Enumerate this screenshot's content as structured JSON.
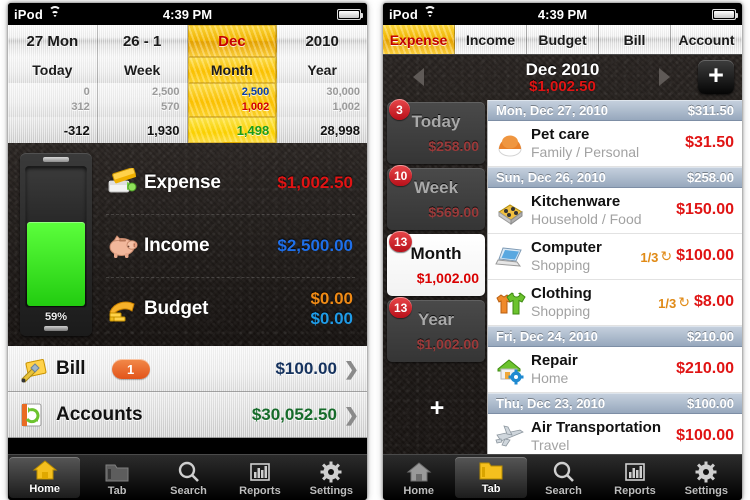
{
  "status_bar": {
    "carrier": "iPod",
    "time": "4:39 PM",
    "wifi_icon": "wifi-icon",
    "battery_icon": "battery-icon"
  },
  "home": {
    "summary": {
      "periods": [
        "27 Mon",
        "26 - 1",
        "Dec",
        "2010"
      ],
      "labels": [
        "Today",
        "Week",
        "Month",
        "Year"
      ],
      "income_row": [
        "0",
        "2,500",
        "2,500",
        "30,000"
      ],
      "expense_row": [
        "312",
        "570",
        "1,002",
        "1,002"
      ],
      "totals": [
        "-312",
        "1,930",
        "1,498",
        "28,998"
      ],
      "selected_index": 2
    },
    "battery": {
      "percent_label": "59%",
      "fill_percent": 59
    },
    "money_rows": [
      {
        "icon": "expense-icon",
        "label": "Expense",
        "values": [
          {
            "text": "$1,002.50",
            "color": "#e01414"
          }
        ]
      },
      {
        "icon": "piggy-bank-icon",
        "label": "Income",
        "values": [
          {
            "text": "$2,500.00",
            "color": "#1f6fe8"
          }
        ]
      },
      {
        "icon": "budget-icon",
        "label": "Budget",
        "values": [
          {
            "text": "$0.00",
            "color": "#f08a15"
          },
          {
            "text": "$0.00",
            "color": "#1f9be8"
          }
        ]
      }
    ],
    "list_rows": [
      {
        "icon": "bill-icon",
        "label": "Bill",
        "badge": "1",
        "value": "$100.00",
        "value_color": "#15325e",
        "chevron": "chevron-right-icon"
      },
      {
        "icon": "accounts-icon",
        "label": "Accounts",
        "badge": null,
        "value": "$30,052.50",
        "value_color": "#166b2a",
        "chevron": "chevron-right-icon"
      }
    ]
  },
  "tab_detail": {
    "segments": [
      "Expense",
      "Income",
      "Budget",
      "Bill",
      "Account"
    ],
    "selected_segment": 0,
    "nav": {
      "prev_icon": "triangle-left-icon",
      "next_icon": "triangle-right-icon",
      "title": "Dec 2010",
      "amount": "$1,002.50",
      "add_label": "+"
    },
    "side_cards": [
      {
        "badge": "3",
        "name": "Today",
        "amount": "$258.00",
        "selected": false
      },
      {
        "badge": "10",
        "name": "Week",
        "amount": "$569.00",
        "selected": false
      },
      {
        "badge": "13",
        "name": "Month",
        "amount": "$1,002.00",
        "selected": true
      },
      {
        "badge": "13",
        "name": "Year",
        "amount": "$1,002.00",
        "selected": false
      }
    ],
    "side_add_label": "+",
    "groups": [
      {
        "date": "Mon, Dec 27, 2010",
        "total": "$311.50",
        "entries": [
          {
            "icon": "pet-care-icon",
            "title": "Pet care",
            "category": "Family / Personal",
            "recurrence": null,
            "amount": "$31.50"
          }
        ]
      },
      {
        "date": "Sun, Dec 26, 2010",
        "total": "$258.00",
        "entries": [
          {
            "icon": "kitchenware-icon",
            "title": "Kitchenware",
            "category": "Household / Food",
            "recurrence": null,
            "amount": "$150.00"
          },
          {
            "icon": "computer-icon",
            "title": "Computer",
            "category": "Shopping",
            "recurrence": "1/3",
            "amount": "$100.00"
          },
          {
            "icon": "clothing-icon",
            "title": "Clothing",
            "category": "Shopping",
            "recurrence": "1/3",
            "amount": "$8.00"
          }
        ]
      },
      {
        "date": "Fri, Dec 24, 2010",
        "total": "$210.00",
        "entries": [
          {
            "icon": "repair-icon",
            "title": "Repair",
            "category": "Home",
            "recurrence": null,
            "amount": "$210.00"
          }
        ]
      },
      {
        "date": "Thu, Dec 23, 2010",
        "total": "$100.00",
        "entries": [
          {
            "icon": "airplane-icon",
            "title": "Air Transportation",
            "category": "Travel",
            "recurrence": null,
            "amount": "$100.00"
          }
        ]
      }
    ]
  },
  "tabbar": {
    "items": [
      {
        "icon": "home-icon",
        "label": "Home"
      },
      {
        "icon": "folder-icon",
        "label": "Tab"
      },
      {
        "icon": "search-icon",
        "label": "Search"
      },
      {
        "icon": "reports-icon",
        "label": "Reports"
      },
      {
        "icon": "settings-gear-icon",
        "label": "Settings"
      }
    ],
    "left_active_index": 0,
    "right_active_index": 1
  },
  "colors": {
    "gold": "#ffd400",
    "red": "#e01414",
    "blue": "#1f6fe8",
    "green": "#1a9c1a",
    "orange": "#f08a15"
  }
}
